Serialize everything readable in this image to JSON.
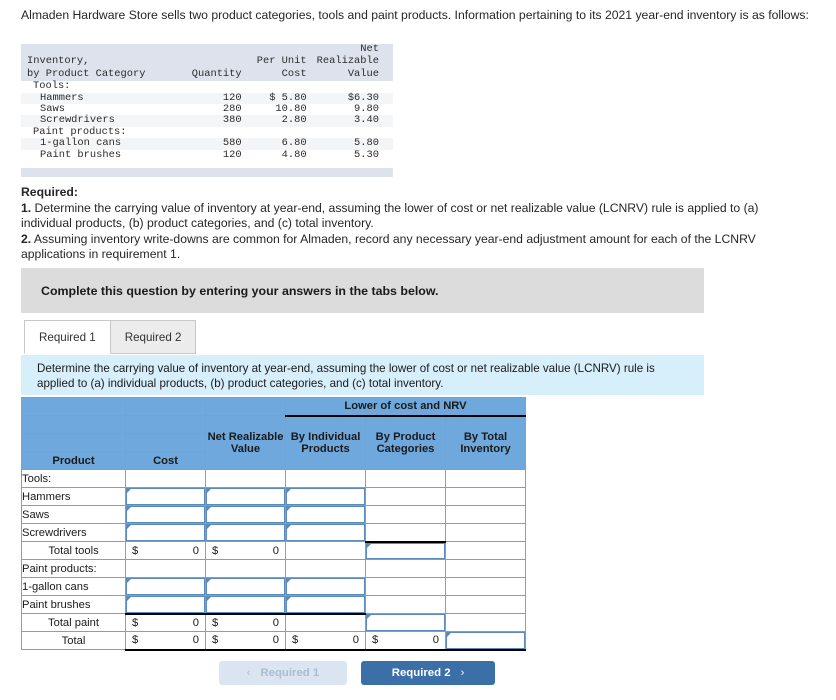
{
  "intro": "Almaden Hardware Store sells two product categories, tools and paint products. Information pertaining to its 2021 year-end inventory is as follows:",
  "inventory_table": {
    "headers": {
      "col1_line1": "Inventory,",
      "col1_line2": "by Product Category",
      "col2_line1": "",
      "col2_line2": "Quantity",
      "col3_line1": "Per Unit",
      "col3_line2": "Cost",
      "col4_line1": "Net",
      "col4_line2": "Realizable",
      "col4_line3": "Value"
    },
    "rows": [
      {
        "label": "Tools:",
        "indent": 1,
        "quantity": "",
        "cost": "",
        "nrv": "",
        "zebra": false
      },
      {
        "label": "Hammers",
        "indent": 2,
        "quantity": "120",
        "cost": "$ 5.80",
        "nrv": "$6.30",
        "zebra": true
      },
      {
        "label": "Saws",
        "indent": 2,
        "quantity": "280",
        "cost": "10.80",
        "nrv": "9.80",
        "zebra": false
      },
      {
        "label": "Screwdrivers",
        "indent": 2,
        "quantity": "380",
        "cost": "2.80",
        "nrv": "3.40",
        "zebra": true
      },
      {
        "label": "Paint products:",
        "indent": 1,
        "quantity": "",
        "cost": "",
        "nrv": "",
        "zebra": false
      },
      {
        "label": "1-gallon cans",
        "indent": 2,
        "quantity": "580",
        "cost": "6.80",
        "nrv": "5.80",
        "zebra": true
      },
      {
        "label": "Paint brushes",
        "indent": 2,
        "quantity": "120",
        "cost": "4.80",
        "nrv": "5.30",
        "zebra": false
      }
    ]
  },
  "required": {
    "heading": "Required:",
    "item1_num": "1.",
    "item1_text": " Determine the carrying value of inventory at year-end, assuming the lower of cost or net realizable value (LCNRV) rule is applied to (a) individual products, (b) product categories, and (c) total inventory.",
    "item2_num": "2.",
    "item2_text": " Assuming inventory write-downs are common for Almaden, record any necessary year-end adjustment amount for each of the LCNRV applications in requirement 1."
  },
  "banner": {
    "text": "Complete this question by entering your answers in the tabs below."
  },
  "tabs": [
    {
      "label": "Required 1",
      "active": true
    },
    {
      "label": "Required 2",
      "active": false
    }
  ],
  "strip": {
    "text": "Determine the carrying value of inventory at year-end, assuming the lower of cost or net realizable value (LCNRV) rule is applied to (a) individual products, (b) product categories, and (c) total inventory."
  },
  "answer_grid": {
    "group_header": "Lower of cost and NRV",
    "columns": [
      {
        "label": "Product"
      },
      {
        "label": "Cost"
      },
      {
        "label": "Net Realizable Value"
      },
      {
        "label": "By Individual Products"
      },
      {
        "label": "By Product Categories"
      },
      {
        "label": "By Total Inventory"
      }
    ],
    "rows": [
      {
        "label": "Tools:",
        "align": "left",
        "cells": [
          {
            "type": "blank"
          },
          {
            "type": "blank"
          },
          {
            "type": "blank"
          },
          {
            "type": "blank"
          },
          {
            "type": "blank"
          }
        ]
      },
      {
        "label": "Hammers",
        "align": "indent",
        "cells": [
          {
            "type": "input"
          },
          {
            "type": "input"
          },
          {
            "type": "input"
          },
          {
            "type": "blank"
          },
          {
            "type": "blank"
          }
        ]
      },
      {
        "label": "Saws",
        "align": "indent",
        "cells": [
          {
            "type": "input"
          },
          {
            "type": "input"
          },
          {
            "type": "input"
          },
          {
            "type": "blank"
          },
          {
            "type": "blank"
          }
        ]
      },
      {
        "label": "Screwdrivers",
        "align": "indent",
        "cells": [
          {
            "type": "input"
          },
          {
            "type": "input"
          },
          {
            "type": "input"
          },
          {
            "type": "blank"
          },
          {
            "type": "blank"
          }
        ]
      },
      {
        "label": "Total tools",
        "align": "center",
        "cells": [
          {
            "type": "money",
            "symbol": "$",
            "value": "0"
          },
          {
            "type": "money",
            "symbol": "$",
            "value": "0"
          },
          {
            "type": "blank"
          },
          {
            "type": "input"
          },
          {
            "type": "blank"
          }
        ]
      },
      {
        "label": "Paint products:",
        "align": "left",
        "cells": [
          {
            "type": "blank"
          },
          {
            "type": "blank"
          },
          {
            "type": "blank"
          },
          {
            "type": "blank"
          },
          {
            "type": "blank"
          }
        ]
      },
      {
        "label": "1-gallon cans",
        "align": "indent",
        "cells": [
          {
            "type": "input"
          },
          {
            "type": "input"
          },
          {
            "type": "input"
          },
          {
            "type": "blank"
          },
          {
            "type": "blank"
          }
        ]
      },
      {
        "label": "Paint brushes",
        "align": "indent",
        "cells": [
          {
            "type": "input"
          },
          {
            "type": "input"
          },
          {
            "type": "input"
          },
          {
            "type": "blank"
          },
          {
            "type": "blank"
          }
        ]
      },
      {
        "label": "Total paint",
        "align": "center",
        "cells": [
          {
            "type": "money",
            "symbol": "$",
            "value": "0"
          },
          {
            "type": "money",
            "symbol": "$",
            "value": "0"
          },
          {
            "type": "blank"
          },
          {
            "type": "input"
          },
          {
            "type": "blank"
          }
        ]
      },
      {
        "label": "Total",
        "align": "center",
        "cells": [
          {
            "type": "money",
            "symbol": "$",
            "value": "0"
          },
          {
            "type": "money",
            "symbol": "$",
            "value": "0"
          },
          {
            "type": "money",
            "symbol": "$",
            "value": "0"
          },
          {
            "type": "money",
            "symbol": "$",
            "value": "0"
          },
          {
            "type": "input"
          }
        ]
      }
    ]
  },
  "nav": {
    "prev_label": "Required 1",
    "prev_chevron": "‹",
    "next_label": "Required 2",
    "next_chevron": "›"
  },
  "colors": {
    "header_blue": "#6fa8dc",
    "strip_blue": "#d7eefb",
    "banner_gray": "#dcdcdc",
    "btn_next_blue": "#3a6fa8",
    "btn_prev_blue": "#dbe5f1",
    "input_border": "#5a8bbd",
    "inv_header_bg": "#dde2ec"
  }
}
